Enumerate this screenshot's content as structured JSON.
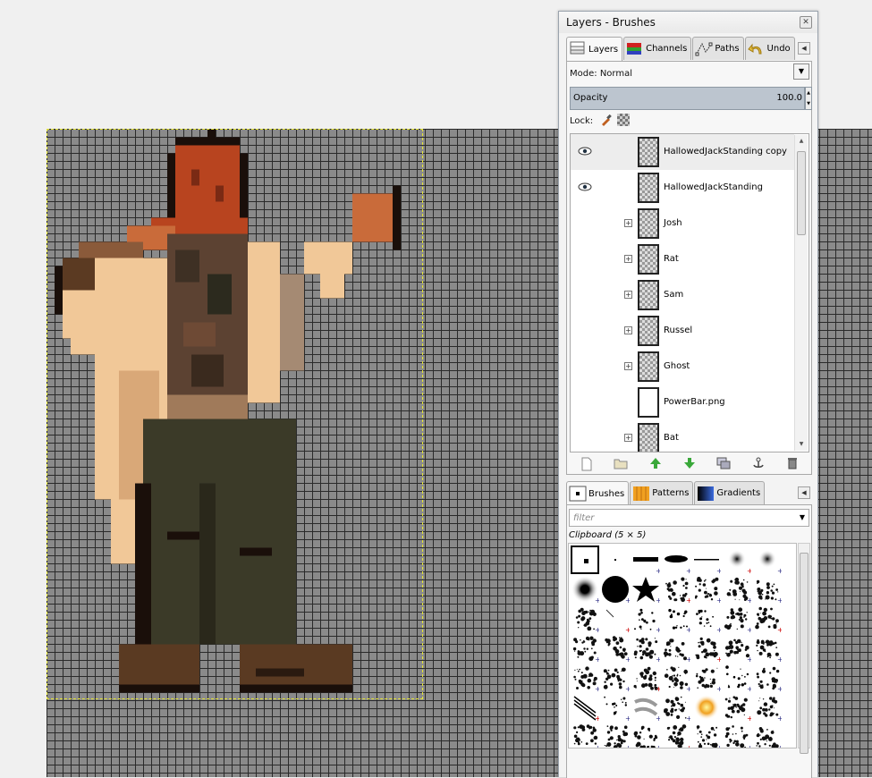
{
  "dock": {
    "title": "Layers - Brushes",
    "close_icon": "close-icon",
    "upper_tabs": [
      {
        "label": "Layers",
        "icon": "layers-icon",
        "active": true
      },
      {
        "label": "Channels",
        "icon": "channels-icon",
        "active": false
      },
      {
        "label": "Paths",
        "icon": "paths-icon",
        "active": false
      },
      {
        "label": "Undo",
        "icon": "undo-icon",
        "active": false
      }
    ],
    "mode_label": "Mode:",
    "mode_value": "Normal",
    "opacity_label": "Opacity",
    "opacity_value": "100.0",
    "lock_label": "Lock:",
    "layers": [
      {
        "name": "HallowedJackStanding copy",
        "visible": true,
        "group": false,
        "selected": true
      },
      {
        "name": "HallowedJackStanding",
        "visible": true,
        "group": false,
        "selected": false
      },
      {
        "name": "Josh",
        "visible": false,
        "group": true,
        "selected": false
      },
      {
        "name": "Rat",
        "visible": false,
        "group": true,
        "selected": false
      },
      {
        "name": "Sam",
        "visible": false,
        "group": true,
        "selected": false
      },
      {
        "name": "Russel",
        "visible": false,
        "group": true,
        "selected": false
      },
      {
        "name": "Ghost",
        "visible": false,
        "group": true,
        "selected": false
      },
      {
        "name": "PowerBar.png",
        "visible": false,
        "group": false,
        "selected": false
      },
      {
        "name": "Bat",
        "visible": false,
        "group": true,
        "selected": false
      }
    ],
    "layer_tools": [
      "new-layer-icon",
      "new-group-icon",
      "raise-layer-icon",
      "lower-layer-icon",
      "duplicate-layer-icon",
      "anchor-layer-icon",
      "delete-layer-icon"
    ],
    "lower_tabs": [
      {
        "label": "Brushes",
        "icon": "brushes-icon",
        "active": true
      },
      {
        "label": "Patterns",
        "icon": "patterns-icon",
        "active": false
      },
      {
        "label": "Gradients",
        "icon": "gradients-icon",
        "active": false
      }
    ],
    "filter_placeholder": "filter",
    "brush_name": "Clipboard (5 × 5)"
  },
  "colors": {
    "grid_bg": "#8a8a8a",
    "selection_border": "#e8e830",
    "opacity_bar": "#bcc5cf"
  }
}
